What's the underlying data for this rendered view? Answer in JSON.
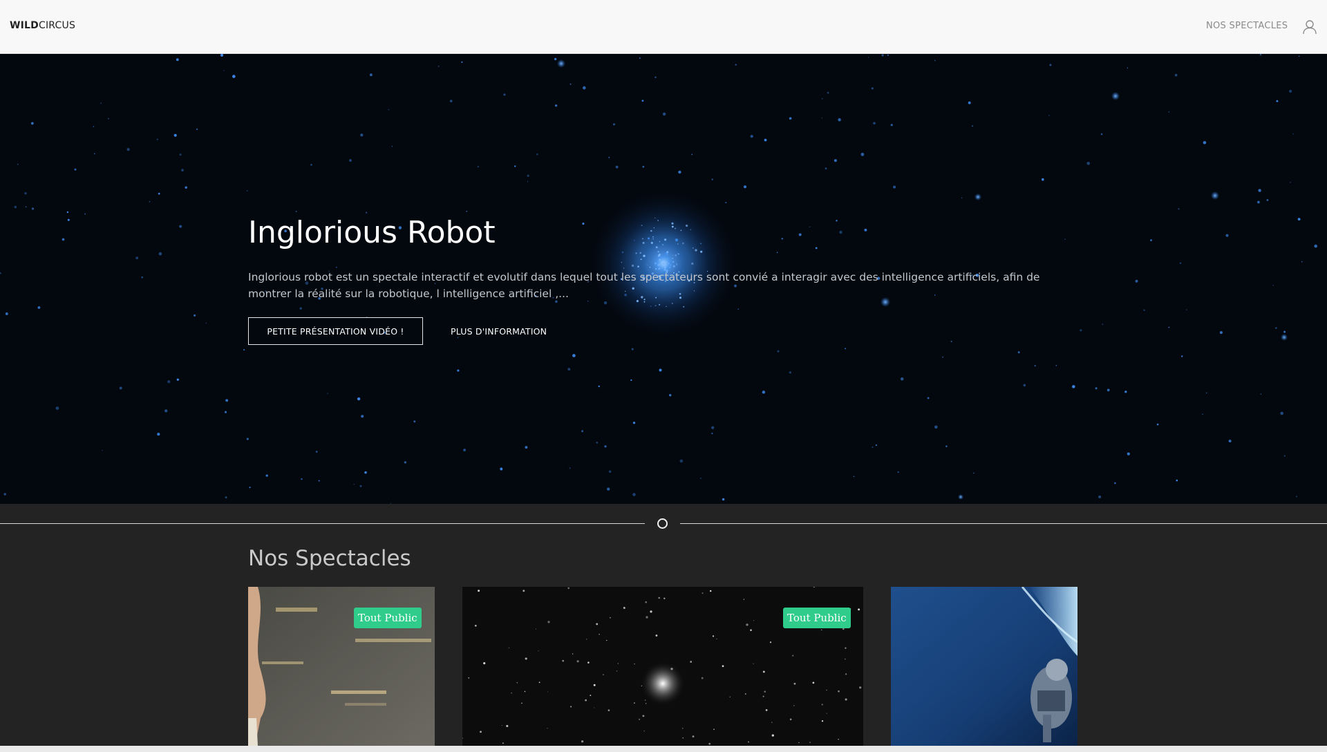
{
  "navbar": {
    "brand_bold": "WILD",
    "brand_light": "CIRCUS",
    "nav_link": "NOS SPECTACLES",
    "user_icon": "user-icon"
  },
  "hero": {
    "title": "Inglorious Robot",
    "description": "Inglorious robot est un spectale interactif et evolutif dans lequel tout les spectateurs sont convié a interagir avec des intelligence artificiels, afin de montrer la réalité sur la robotique, l intelligence artificiel ,...",
    "primary_button": "PETITE PRÉSENTATION VIDÉO !",
    "secondary_button": "PLUS D'INFORMATION"
  },
  "section": {
    "title": "Nos Spectacles",
    "cards": [
      {
        "badge": "Tout Public"
      },
      {
        "badge": "Tout Public"
      },
      {
        "badge": ""
      }
    ]
  },
  "colors": {
    "navbar_bg": "#f8f8f8",
    "hero_bg": "#03080f",
    "page_bg": "#232323",
    "badge_bg": "#2fcc8b",
    "star_blue": "#3f8ef5"
  }
}
